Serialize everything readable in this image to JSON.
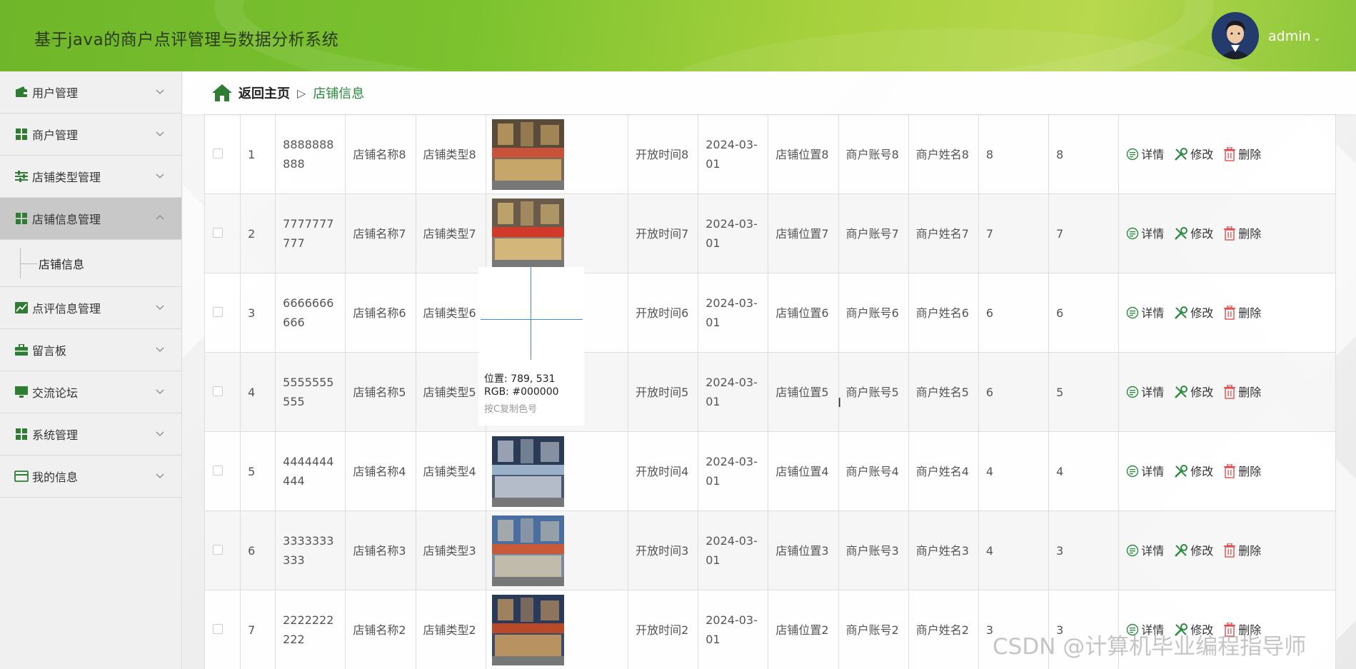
{
  "header": {
    "title": "基于java的商户点评管理与数据分析系统",
    "username": "admin"
  },
  "sidebar": {
    "items": [
      {
        "label": "用户管理",
        "icon": "wallet-icon",
        "expanded": false
      },
      {
        "label": "商户管理",
        "icon": "grid-icon",
        "expanded": false
      },
      {
        "label": "店铺类型管理",
        "icon": "sliders-icon",
        "expanded": false
      },
      {
        "label": "店铺信息管理",
        "icon": "grid-icon",
        "expanded": true
      },
      {
        "label": "点评信息管理",
        "icon": "chart-line-icon",
        "expanded": false
      },
      {
        "label": "留言板",
        "icon": "briefcase-icon",
        "expanded": false
      },
      {
        "label": "交流论坛",
        "icon": "monitor-icon",
        "expanded": false
      },
      {
        "label": "系统管理",
        "icon": "grid-icon",
        "expanded": false
      },
      {
        "label": "我的信息",
        "icon": "card-icon",
        "expanded": false
      }
    ],
    "subitem": {
      "label": "店铺信息"
    }
  },
  "breadcrumb": {
    "home": "返回主页",
    "separator": "▷",
    "current": "店铺信息"
  },
  "table": {
    "rows": [
      {
        "index": "1",
        "code": "8888888888",
        "name": "店铺名称8",
        "type": "店铺类型8",
        "image": "storefront-photo",
        "open_time": "开放时间8",
        "date": "2024-03-01",
        "location": "店铺位置8",
        "account": "商户账号8",
        "merchant": "商户姓名8",
        "c1": "8",
        "c2": "8"
      },
      {
        "index": "2",
        "code": "7777777777",
        "name": "店铺名称7",
        "type": "店铺类型7",
        "image": "storefront-photo",
        "open_time": "开放时间7",
        "date": "2024-03-01",
        "location": "店铺位置7",
        "account": "商户账号7",
        "merchant": "商户姓名7",
        "c1": "7",
        "c2": "7"
      },
      {
        "index": "3",
        "code": "6666666666",
        "name": "店铺名称6",
        "type": "店铺类型6",
        "image": "",
        "open_time": "开放时间6",
        "date": "2024-03-01",
        "location": "店铺位置6",
        "account": "商户账号6",
        "merchant": "商户姓名6",
        "c1": "6",
        "c2": "6"
      },
      {
        "index": "4",
        "code": "5555555555",
        "name": "店铺名称5",
        "type": "店铺类型5",
        "image": "",
        "open_time": "开放时间5",
        "date": "2024-03-01",
        "location": "店铺位置5",
        "account": "商户账号5",
        "merchant": "商户姓名5",
        "c1": "6",
        "c2": "5"
      },
      {
        "index": "5",
        "code": "4444444444",
        "name": "店铺名称4",
        "type": "店铺类型4",
        "image": "storefront-photo",
        "open_time": "开放时间4",
        "date": "2024-03-01",
        "location": "店铺位置4",
        "account": "商户账号4",
        "merchant": "商户姓名4",
        "c1": "4",
        "c2": "4"
      },
      {
        "index": "6",
        "code": "3333333333",
        "name": "店铺名称3",
        "type": "店铺类型3",
        "image": "storefront-photo",
        "open_time": "开放时间3",
        "date": "2024-03-01",
        "location": "店铺位置3",
        "account": "商户账号3",
        "merchant": "商户姓名3",
        "c1": "4",
        "c2": "3"
      },
      {
        "index": "7",
        "code": "2222222222",
        "name": "店铺名称2",
        "type": "店铺类型2",
        "image": "storefront-photo",
        "open_time": "开放时间2",
        "date": "2024-03-01",
        "location": "店铺位置2",
        "account": "商户账号2",
        "merchant": "商户姓名2",
        "c1": "3",
        "c2": "3"
      }
    ],
    "actions": {
      "detail": "详情",
      "edit": "修改",
      "delete": "删除"
    }
  },
  "color_picker": {
    "position": "位置: 789, 531",
    "rgb": "RGB: #000000",
    "hint": "按C复制色号"
  },
  "watermark": "CSDN @计算机毕业编程指导师",
  "colors": {
    "header_green": "#7cc22f",
    "sidebar_icon_green": "#2e7d32",
    "breadcrumb_current": "#2a8a3e",
    "action_detail": "#2a8a3e",
    "action_edit": "#2a8a3e",
    "action_delete": "#e05050"
  }
}
